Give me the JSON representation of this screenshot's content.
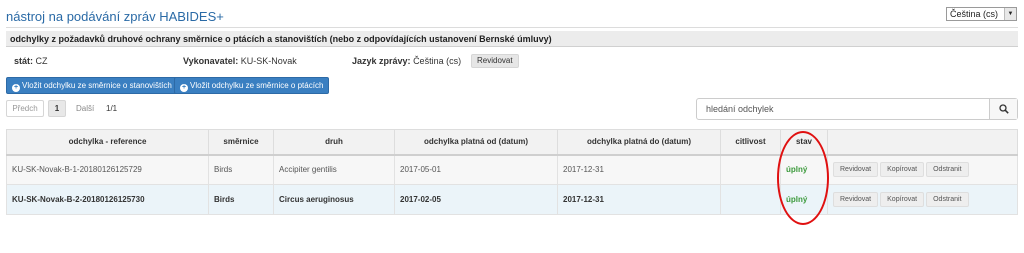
{
  "app": {
    "title": "nástroj na podávání zpráv HABIDES+",
    "language_select": "Čeština (cs)"
  },
  "section_header": "odchylky z požadavků druhové ochrany směrnice o ptácích a stanovištích (nebo z odpovídajících ustanovení Bernské úmluvy)",
  "meta": {
    "country_label": "stát:",
    "country_value": "CZ",
    "executor_label": "Vykonavatel:",
    "executor_value": "KU-SK-Novak",
    "lang_label": "Jazyk zprávy:",
    "lang_value": "Čeština (cs)",
    "revise_label": "Revidovat"
  },
  "actions": {
    "add_habitats": "Vložit odchylku ze směrnice o stanovištích",
    "add_birds": "Vložit odchylku ze směrnice o ptácích"
  },
  "pager": {
    "prev": "Předch",
    "current": "1",
    "next": "Další",
    "total": "1/1"
  },
  "search": {
    "placeholder": "hledání odchylek"
  },
  "table": {
    "columns": [
      "odchylka - reference",
      "směrnice",
      "druh",
      "odchylka platná od (datum)",
      "odchylka platná do (datum)",
      "citlivost",
      "stav",
      ""
    ],
    "rows": [
      {
        "reference": "KU-SK-Novak-B-1-20180126125729",
        "directive": "Birds",
        "species": "Accipiter gentilis",
        "valid_from": "2017-05-01",
        "valid_to": "2017-12-31",
        "sensitivity": "",
        "status": "úplný",
        "btn_revise": "Revidovat",
        "btn_copy": "Kopírovat",
        "btn_delete": "Odstranit"
      },
      {
        "reference": "KU-SK-Novak-B-2-20180126125730",
        "directive": "Birds",
        "species": "Circus aeruginosus",
        "valid_from": "2017-02-05",
        "valid_to": "2017-12-31",
        "sensitivity": "",
        "status": "úplný",
        "btn_revise": "Revidovat",
        "btn_copy": "Kopírovat",
        "btn_delete": "Odstranit"
      }
    ]
  },
  "colors": {
    "primary": "#3a7fc1",
    "title": "#2a6aa6",
    "status_ok": "#3c9a3c",
    "highlight": "#e01010"
  }
}
